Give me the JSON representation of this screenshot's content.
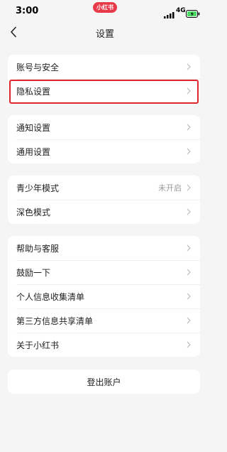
{
  "status_bar": {
    "time": "3:00",
    "app_badge": "小红书",
    "network": "4G"
  },
  "header": {
    "title": "设置"
  },
  "groups": [
    {
      "items": [
        {
          "label": "账号与安全"
        },
        {
          "label": "隐私设置",
          "highlighted": true
        }
      ]
    },
    {
      "items": [
        {
          "label": "通知设置"
        },
        {
          "label": "通用设置"
        }
      ]
    },
    {
      "items": [
        {
          "label": "青少年模式",
          "value": "未开启"
        },
        {
          "label": "深色模式"
        }
      ]
    },
    {
      "items": [
        {
          "label": "帮助与客服"
        },
        {
          "label": "鼓励一下"
        },
        {
          "label": "个人信息收集清单"
        },
        {
          "label": "第三方信息共享清单"
        },
        {
          "label": "关于小红书"
        }
      ]
    }
  ],
  "logout": {
    "label": "登出账户"
  },
  "colors": {
    "background": "#f5f5f5",
    "highlight_border": "#e0242c",
    "brand": "#e8394a",
    "battery_fill": "#4cd964"
  }
}
